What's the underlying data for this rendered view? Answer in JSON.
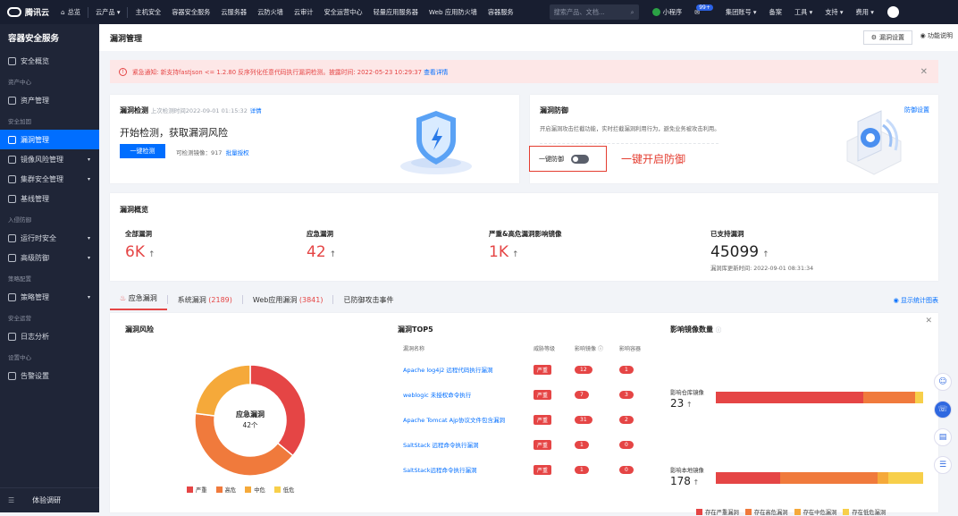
{
  "topbar": {
    "logo": "腾讯云",
    "home": "总览",
    "nav": [
      "云产品",
      "主机安全",
      "容器安全服务",
      "云服务器",
      "云防火墙",
      "云审计",
      "安全运营中心",
      "轻量应用服务器",
      "Web 应用防火墙",
      "容器服务"
    ],
    "search_placeholder": "搜索产品、文档...",
    "right": {
      "mini": "小程序",
      "badge": "99+",
      "account": "集团账号",
      "beian": "备案",
      "tools": "工具",
      "support": "支持",
      "fee": "费用"
    }
  },
  "sidebar": {
    "title": "容器安全服务",
    "items": [
      {
        "type": "item",
        "label": "安全概览",
        "icon": "grid-icon"
      },
      {
        "type": "group",
        "label": "资产中心"
      },
      {
        "type": "item",
        "label": "资产管理",
        "icon": "asset-icon"
      },
      {
        "type": "group",
        "label": "安全加固"
      },
      {
        "type": "item",
        "label": "漏洞管理",
        "icon": "bug-icon",
        "active": true
      },
      {
        "type": "item",
        "label": "镜像风险管理",
        "icon": "image-icon",
        "caret": true
      },
      {
        "type": "item",
        "label": "集群安全管理",
        "icon": "cluster-icon",
        "caret": true
      },
      {
        "type": "item",
        "label": "基线管理",
        "icon": "baseline-icon"
      },
      {
        "type": "group",
        "label": "入侵防御"
      },
      {
        "type": "item",
        "label": "运行时安全",
        "icon": "runtime-icon",
        "caret": true
      },
      {
        "type": "item",
        "label": "高级防御",
        "icon": "shield-icon",
        "caret": true
      },
      {
        "type": "group",
        "label": "策略配置"
      },
      {
        "type": "item",
        "label": "策略管理",
        "icon": "policy-icon",
        "caret": true
      },
      {
        "type": "group",
        "label": "安全运营"
      },
      {
        "type": "item",
        "label": "日志分析",
        "icon": "log-icon"
      },
      {
        "type": "group",
        "label": "设置中心"
      },
      {
        "type": "item",
        "label": "告警设置",
        "icon": "bell-icon"
      }
    ],
    "footer": "体验调研"
  },
  "page": {
    "title": "漏洞管理",
    "settings_btn": "漏洞设置",
    "help": "功能说明"
  },
  "alert": {
    "text": "紧急通知: 新支持fastjson <= 1.2.80 反序列化任意代码执行漏洞检测。披露时间: 2022-05-23 10:29:37",
    "link": "查看详情"
  },
  "detect": {
    "title": "漏洞检测",
    "last_time": "上次检测时间2022-09-01 01:15:32",
    "detail": "详情",
    "headline": "开始检测，获取漏洞风险",
    "button": "一键检测",
    "images_label": "可检测镜像：",
    "images_count": "917",
    "batch": "批量授权"
  },
  "defense": {
    "title": "漏洞防御",
    "settings": "防御设置",
    "desc": "开启漏洞攻击拦截功能，实时拦截漏洞利用行为，避免业务被攻击利用。",
    "toggle_label": "一键防御",
    "annotation": "一键开启防御"
  },
  "overview": {
    "title": "漏洞概览",
    "stats": [
      {
        "label": "全部漏洞",
        "value": "6K"
      },
      {
        "label": "应急漏洞",
        "value": "42"
      },
      {
        "label": "严重&高危漏洞影响镜像",
        "value": "1K"
      },
      {
        "label": "已支持漏洞",
        "value": "45099"
      }
    ],
    "updated": "漏洞库更新时间: 2022-09-01 08:31:34"
  },
  "tabs": [
    {
      "label": "应急漏洞",
      "count": ""
    },
    {
      "label": "系统漏洞",
      "count": "(2189)"
    },
    {
      "label": "Web应用漏洞",
      "count": "(3841)"
    },
    {
      "label": "已防御攻击事件",
      "count": ""
    }
  ],
  "show_chart": "显示统计图表",
  "risk": {
    "title": "漏洞风险",
    "center_label": "应急漏洞",
    "center_value": "42个",
    "legend": [
      "严重",
      "高危",
      "中危",
      "低危"
    ]
  },
  "top5": {
    "title": "漏洞TOP5",
    "headers": [
      "漏洞名称",
      "威胁等级",
      "影响镜像",
      "影响容器"
    ],
    "rows": [
      {
        "name": "Apache log4j2 远程代码执行漏洞",
        "level": "严重",
        "images": "12",
        "containers": "1"
      },
      {
        "name": "weblogic 未授权命令执行",
        "level": "严重",
        "images": "7",
        "containers": "3"
      },
      {
        "name": "Apache Tomcat Ajp协议文件包含漏洞",
        "level": "严重",
        "images": "31",
        "containers": "2"
      },
      {
        "name": "SaltStack 远程命令执行漏洞",
        "level": "严重",
        "images": "1",
        "containers": "0"
      },
      {
        "name": "SaltStack远程命令执行漏洞",
        "level": "严重",
        "images": "1",
        "containers": "0"
      }
    ]
  },
  "impact": {
    "title": "影响镜像数量",
    "repo_label": "影响仓库镜像",
    "repo_value": "23",
    "local_label": "影响本地镜像",
    "local_value": "178",
    "legend": [
      "存在严重漏洞",
      "存在高危漏洞",
      "存在中危漏洞",
      "存在低危漏洞"
    ]
  },
  "colors": {
    "critical": "#e54545",
    "high": "#f07a3c",
    "medium": "#f5a93a",
    "low": "#f7cf4a",
    "primary": "#006eff"
  }
}
